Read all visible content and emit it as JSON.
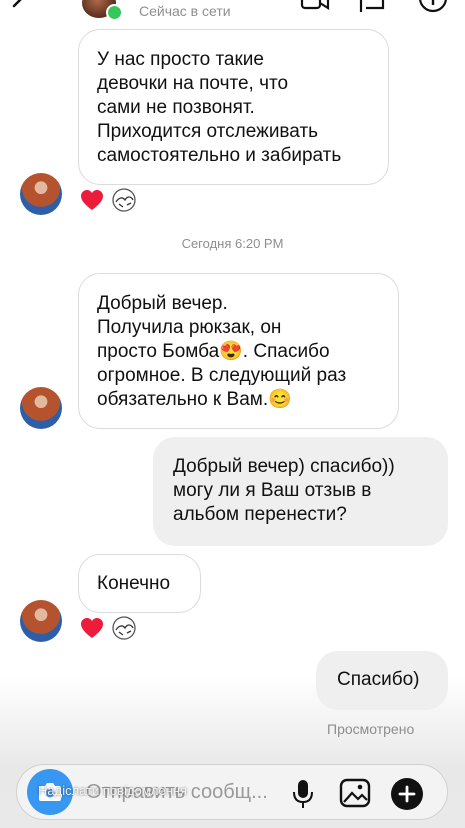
{
  "header": {
    "status": "Сейчас в сети"
  },
  "messages": [
    {
      "side": "in",
      "text": "У нас просто такие\nдевочки на почте, что\nсами не позвонят.\nПриходится отслеживать\nсамостоятельно и забирать"
    },
    {
      "side": "in",
      "text": "Добрый вечер.\nПолучила рюкзак, он\nпросто Бомба😍. Спасибо\nогромное. В следующий раз\nобязательно к Вам.😊"
    },
    {
      "side": "out",
      "text": "Добрый вечер) спасибо))\nмогу ли я Ваш отзыв в\nальбом перенести?"
    },
    {
      "side": "in",
      "text": "Конечно"
    },
    {
      "side": "out",
      "text": "Спасибо)"
    }
  ],
  "timestamp": "Сегодня 6:20 PM",
  "seen_label": "Просмотрено",
  "composer": {
    "placeholder": "Отправить сообщ...",
    "overlay_caption": "Надіслати повідомлення"
  },
  "icons": [
    "back-icon",
    "video-call-icon",
    "flag-icon",
    "info-icon",
    "heart-reaction-icon",
    "sticker-reaction-icon",
    "camera-icon",
    "microphone-icon",
    "gallery-icon",
    "plus-icon"
  ],
  "colors": {
    "online": "#35c759",
    "camera_button": "#3897f0",
    "heart": "#ed1c3a",
    "outgoing_bubble": "#efefef"
  }
}
